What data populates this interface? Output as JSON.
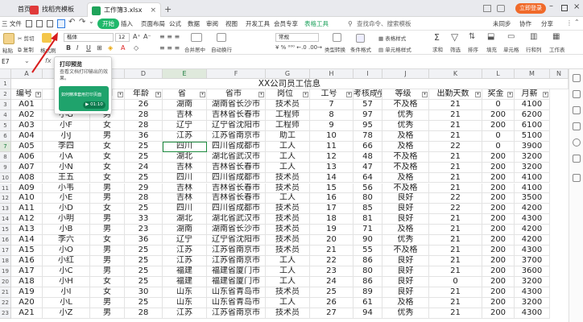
{
  "tabs": {
    "home": "首页",
    "template": "找稻壳模板",
    "file": "工作簿3.xlsx",
    "login": "立即登录"
  },
  "menu": {
    "file": "三 文件",
    "start": "开始",
    "insert": "插入",
    "pagelayout": "页面布局",
    "formula": "公式",
    "data": "数据",
    "review": "审阅",
    "view": "视图",
    "dev": "开发工具",
    "vip": "会员专享",
    "tabletools": "表格工具",
    "search": "查找命令、搜索模板",
    "unsync": "未同步",
    "collab": "协作",
    "share": "分享"
  },
  "ribbon": {
    "cut": "剪切",
    "copy": "复制",
    "paste": "粘贴",
    "painter": "格式刷",
    "font": "楷体",
    "size": "12",
    "merge": "合并居中",
    "wrap": "自动换行",
    "numfmt": "常规",
    "typeconv": "类型转换",
    "condfmt": "条件格式",
    "tablestyle": "表格样式",
    "cellstyle": "单元格样式",
    "sum": "求和",
    "filter": "筛选",
    "sort": "排序",
    "fill": "填充",
    "cell": "单元格",
    "rowcol": "行和列",
    "worksheet": "工作表"
  },
  "formula_bar": {
    "namebox": "E7",
    "fx": "fx"
  },
  "popup": {
    "title": "打印预览",
    "desc": "查看文档打印输出的效果。",
    "video_title": "如何精准套用打印页面",
    "time": "01:10"
  },
  "columns": [
    "A",
    "B",
    "C",
    "D",
    "E",
    "F",
    "G",
    "H",
    "I",
    "J",
    "K",
    "L",
    "M",
    "N",
    "O"
  ],
  "sheet_title": "XX公司员工信息",
  "headers": [
    "编号",
    "姓名",
    "性别",
    "年龄",
    "省",
    "省市",
    "岗位",
    "工号",
    "考核成绩",
    "等级",
    "出勤天数",
    "奖金",
    "月薪"
  ],
  "rows": [
    [
      "A01",
      "小J",
      "男",
      "26",
      "湖南",
      "湖南省长沙市",
      "技术员",
      "7",
      "57",
      "不及格",
      "21",
      "0",
      "4100"
    ],
    [
      "A02",
      "小G",
      "男",
      "28",
      "吉林",
      "吉林省长春市",
      "工程师",
      "8",
      "97",
      "优秀",
      "21",
      "200",
      "6200"
    ],
    [
      "A03",
      "小F",
      "女",
      "28",
      "辽宁",
      "辽宁省沈阳市",
      "工程师",
      "9",
      "95",
      "优秀",
      "21",
      "200",
      "6100"
    ],
    [
      "A04",
      "小J",
      "男",
      "36",
      "江苏",
      "江苏省南京市",
      "助工",
      "10",
      "78",
      "及格",
      "21",
      "0",
      "5100"
    ],
    [
      "A05",
      "李四",
      "女",
      "25",
      "四川",
      "四川省成都市",
      "工人",
      "11",
      "66",
      "及格",
      "22",
      "0",
      "3900"
    ],
    [
      "A06",
      "小A",
      "女",
      "25",
      "湖北",
      "湖北省武汉市",
      "工人",
      "12",
      "48",
      "不及格",
      "21",
      "200",
      "3200"
    ],
    [
      "A07",
      "小N",
      "女",
      "24",
      "吉林",
      "吉林省长春市",
      "工人",
      "13",
      "47",
      "不及格",
      "21",
      "200",
      "3200"
    ],
    [
      "A08",
      "王五",
      "女",
      "25",
      "四川",
      "四川省成都市",
      "技术员",
      "14",
      "64",
      "及格",
      "21",
      "200",
      "4100"
    ],
    [
      "A09",
      "小韦",
      "男",
      "29",
      "吉林",
      "吉林省长春市",
      "技术员",
      "15",
      "56",
      "不及格",
      "21",
      "200",
      "4100"
    ],
    [
      "A10",
      "小E",
      "男",
      "28",
      "吉林",
      "吉林省长春市",
      "工人",
      "16",
      "80",
      "良好",
      "22",
      "200",
      "3500"
    ],
    [
      "A11",
      "小D",
      "女",
      "25",
      "四川",
      "四川省成都市",
      "技术员",
      "17",
      "85",
      "良好",
      "22",
      "200",
      "4200"
    ],
    [
      "A12",
      "小明",
      "男",
      "33",
      "湖北",
      "湖北省武汉市",
      "技术员",
      "18",
      "81",
      "良好",
      "21",
      "200",
      "4300"
    ],
    [
      "A13",
      "小B",
      "男",
      "23",
      "湖南",
      "湖南省长沙市",
      "技术员",
      "19",
      "71",
      "及格",
      "21",
      "200",
      "4200"
    ],
    [
      "A14",
      "李六",
      "女",
      "36",
      "辽宁",
      "辽宁省沈阳市",
      "技术员",
      "20",
      "90",
      "优秀",
      "21",
      "200",
      "4200"
    ],
    [
      "A15",
      "小O",
      "男",
      "25",
      "江苏",
      "江苏省南京市",
      "技术员",
      "21",
      "55",
      "不及格",
      "21",
      "200",
      "4300"
    ],
    [
      "A16",
      "小红",
      "男",
      "25",
      "江苏",
      "江苏省南京市",
      "工人",
      "22",
      "86",
      "良好",
      "21",
      "200",
      "3700"
    ],
    [
      "A17",
      "小C",
      "男",
      "25",
      "福建",
      "福建省厦门市",
      "工人",
      "23",
      "80",
      "良好",
      "21",
      "200",
      "3600"
    ],
    [
      "A18",
      "小H",
      "女",
      "25",
      "福建",
      "福建省厦门市",
      "工人",
      "24",
      "86",
      "良好",
      "0",
      "200",
      "3200"
    ],
    [
      "A19",
      "小I",
      "女",
      "30",
      "山东",
      "山东省青岛市",
      "技术员",
      "25",
      "89",
      "良好",
      "21",
      "200",
      "4300"
    ],
    [
      "A20",
      "小L",
      "男",
      "25",
      "山东",
      "山东省青岛市",
      "工人",
      "26",
      "61",
      "及格",
      "21",
      "200",
      "3200"
    ],
    [
      "A21",
      "小Z",
      "男",
      "28",
      "江苏",
      "江苏省南京市",
      "技术员",
      "27",
      "94",
      "优秀",
      "21",
      "200",
      "4300"
    ]
  ]
}
